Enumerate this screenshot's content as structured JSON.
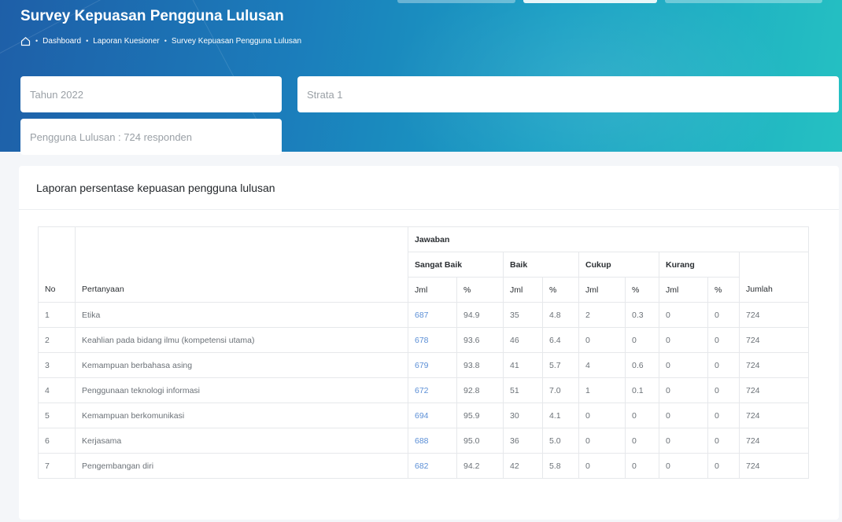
{
  "page": {
    "title": "Survey Kepuasan Pengguna Lulusan",
    "breadcrumb": [
      "Dashboard",
      "Laporan Kuesioner",
      "Survey Kepuasan Pengguna Lulusan"
    ],
    "icons": {
      "home": "home-icon"
    }
  },
  "filters": {
    "year": "Tahun 2022",
    "strata": "Strata 1",
    "respondents": "Pengguna Lulusan : 724 responden"
  },
  "report": {
    "title": "Laporan persentase kepuasan pengguna lulusan",
    "headers": {
      "no": "No",
      "question": "Pertanyaan",
      "answers": "Jawaban",
      "groups": [
        "Sangat Baik",
        "Baik",
        "Cukup",
        "Kurang"
      ],
      "jml": "Jml",
      "pct": "%",
      "total": "Jumlah"
    },
    "rows": [
      {
        "no": "1",
        "question": "Etika",
        "sb_jml": "687",
        "sb_pct": "94.9",
        "b_jml": "35",
        "b_pct": "4.8",
        "c_jml": "2",
        "c_pct": "0.3",
        "k_jml": "0",
        "k_pct": "0",
        "total": "724"
      },
      {
        "no": "2",
        "question": "Keahlian pada bidang ilmu (kompetensi utama)",
        "sb_jml": "678",
        "sb_pct": "93.6",
        "b_jml": "46",
        "b_pct": "6.4",
        "c_jml": "0",
        "c_pct": "0",
        "k_jml": "0",
        "k_pct": "0",
        "total": "724"
      },
      {
        "no": "3",
        "question": "Kemampuan berbahasa asing",
        "sb_jml": "679",
        "sb_pct": "93.8",
        "b_jml": "41",
        "b_pct": "5.7",
        "c_jml": "4",
        "c_pct": "0.6",
        "k_jml": "0",
        "k_pct": "0",
        "total": "724"
      },
      {
        "no": "4",
        "question": "Penggunaan teknologi informasi",
        "sb_jml": "672",
        "sb_pct": "92.8",
        "b_jml": "51",
        "b_pct": "7.0",
        "c_jml": "1",
        "c_pct": "0.1",
        "k_jml": "0",
        "k_pct": "0",
        "total": "724"
      },
      {
        "no": "5",
        "question": "Kemampuan berkomunikasi",
        "sb_jml": "694",
        "sb_pct": "95.9",
        "b_jml": "30",
        "b_pct": "4.1",
        "c_jml": "0",
        "c_pct": "0",
        "k_jml": "0",
        "k_pct": "0",
        "total": "724"
      },
      {
        "no": "6",
        "question": "Kerjasama",
        "sb_jml": "688",
        "sb_pct": "95.0",
        "b_jml": "36",
        "b_pct": "5.0",
        "c_jml": "0",
        "c_pct": "0",
        "k_jml": "0",
        "k_pct": "0",
        "total": "724"
      },
      {
        "no": "7",
        "question": "Pengembangan diri",
        "sb_jml": "682",
        "sb_pct": "94.2",
        "b_jml": "42",
        "b_pct": "5.8",
        "c_jml": "0",
        "c_pct": "0",
        "k_jml": "0",
        "k_pct": "0",
        "total": "724"
      }
    ]
  },
  "colors": {
    "link": "#5b8fd6",
    "hero_start": "#1e5fa8",
    "hero_end": "#25c1c2"
  }
}
